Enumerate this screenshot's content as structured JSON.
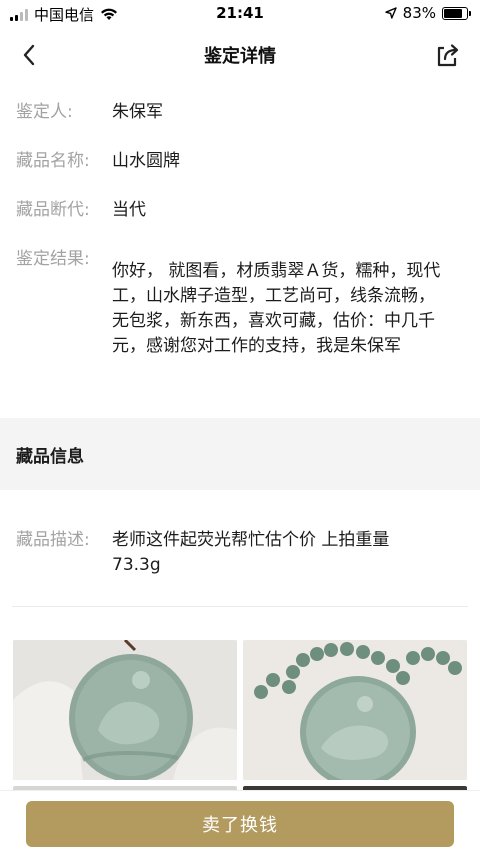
{
  "status_bar": {
    "carrier": "中国电信",
    "time": "21:41",
    "battery": "83%",
    "battery_level": 0.83
  },
  "nav": {
    "title": "鉴定详情"
  },
  "appraisal": {
    "appraiser_label": "鉴定人:",
    "appraiser": "朱保军",
    "name_label": "藏品名称:",
    "name": "山水圆牌",
    "era_label": "藏品断代:",
    "era": "当代",
    "result_label": "鉴定结果:",
    "result": "你好， 就图看，材质翡翠Ａ货，糯种，现代工，山水牌子造型，工艺尚可，线条流畅，无包浆，新东西，喜欢可藏，估价：中几千元，感谢您对工作的支持，我是朱保军"
  },
  "collection_info": {
    "section_title": "藏品信息",
    "desc_label": "藏品描述:",
    "desc": "老师这件起荧光帮忙估个价 上拍重量73.3g"
  },
  "bottom": {
    "sell_label": "卖了换钱"
  },
  "colors": {
    "accent": "#b39a5e",
    "label_gray": "#a3a3a3",
    "section_bg": "#f4f4f4"
  }
}
